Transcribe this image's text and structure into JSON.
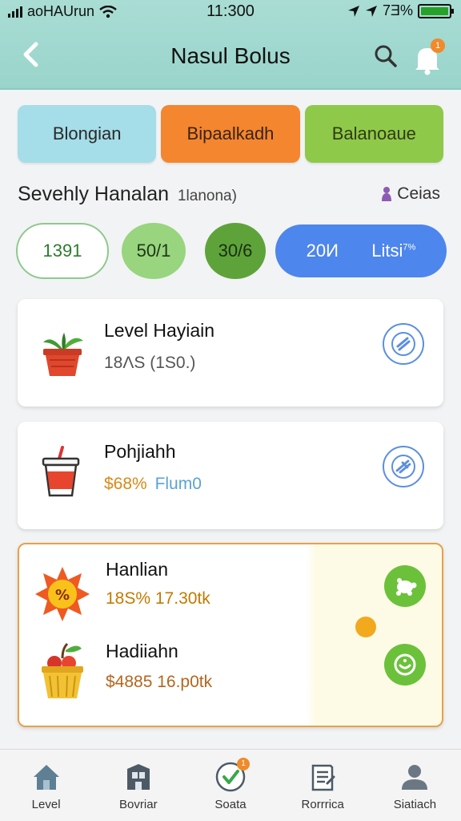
{
  "status_bar": {
    "carrier": "aoHAUrun",
    "time": "11:300",
    "battery_text": "7Ǝ%",
    "battery_level": 1.0
  },
  "header": {
    "title": "Nasul Bolus",
    "notification_count": "1"
  },
  "segments": [
    {
      "label": "Blongian",
      "color": "#a5dde8"
    },
    {
      "label": "Bipaalkadh",
      "color": "#f4862f"
    },
    {
      "label": "Balanoaue",
      "color": "#8fc94a"
    }
  ],
  "section": {
    "title": "Sevehly Hanalan",
    "subtitle": "1lanona)",
    "link_label": "Ceias"
  },
  "filters": [
    {
      "label": "1391"
    },
    {
      "label": "50/1"
    },
    {
      "label": "30/6"
    },
    {
      "label": "20И",
      "secondary": "Litsi",
      "sup": "7%"
    }
  ],
  "items": [
    {
      "name": "Level Hayiain",
      "price": "18ΛS  (1S0.)",
      "price_color": "#555555",
      "icon": "plant-pot-icon",
      "action_icon": "percent-swirl-icon"
    },
    {
      "name": "Pohjiahh",
      "price": "$68%",
      "price_extra": "Flum0",
      "price_color": "#d68a1a",
      "extra_color": "#5aa3d6",
      "icon": "juice-cup-icon",
      "action_icon": "fork-knife-icon"
    },
    {
      "name": "Hanlian",
      "price": "18S%  17.30tk",
      "price_color": "#c27a00",
      "icon": "sun-badge-icon",
      "action_icon": "turtle-icon"
    },
    {
      "name": "Hadiiahn",
      "price": "$4885  16.p0tk",
      "price_color": "#b5651d",
      "icon": "fruit-basket-icon",
      "action_icon": "smile-coin-icon"
    }
  ],
  "tabs": [
    {
      "label": "Level",
      "icon": "home-icon"
    },
    {
      "label": "Bovriar",
      "icon": "cabinet-icon"
    },
    {
      "label": "Soata",
      "icon": "check-shield-icon",
      "badge": "1"
    },
    {
      "label": "Rorrrica",
      "icon": "document-icon"
    },
    {
      "label": "Siatiach",
      "icon": "person-icon"
    }
  ]
}
